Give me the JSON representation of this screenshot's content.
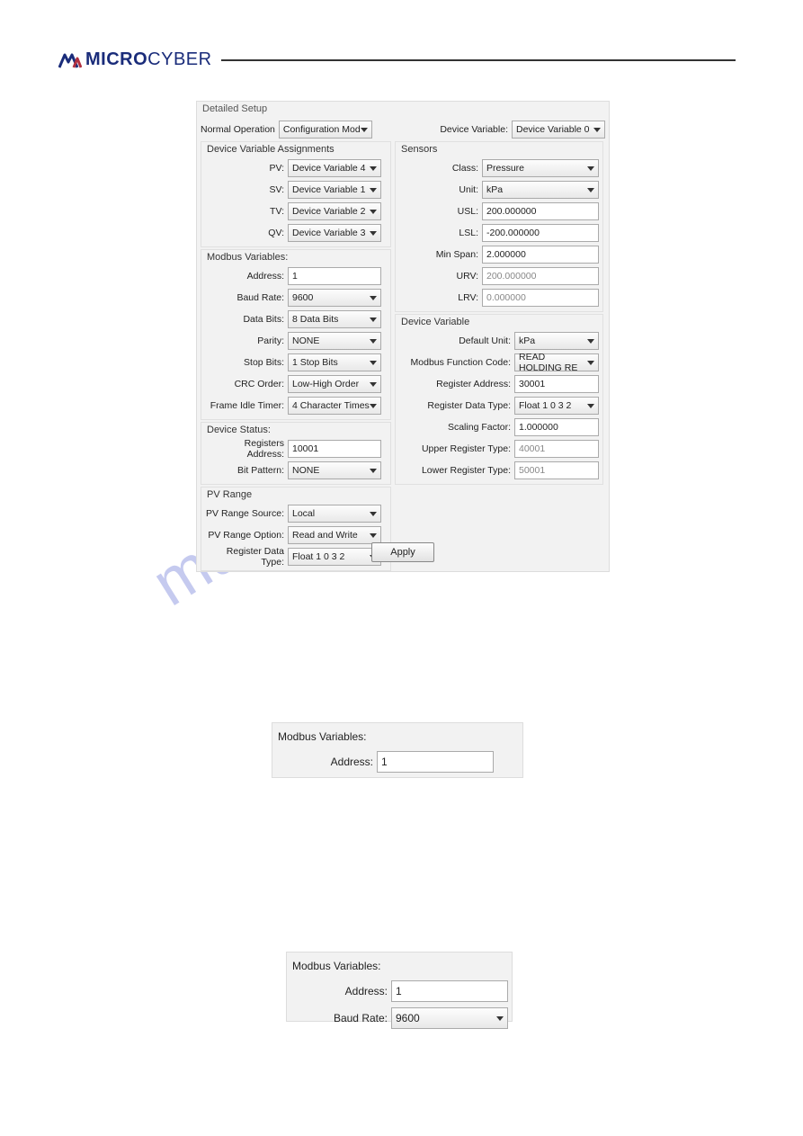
{
  "brand": {
    "name1": "MICRO",
    "name2": "CYBER"
  },
  "watermark": "manualshive.com",
  "dialog": {
    "title": "Detailed Setup",
    "normal_op_label": "Normal Operation",
    "normal_op_value": "Configuration Mod",
    "dev_var_label": "Device Variable:",
    "dev_var_value": "Device Variable 0"
  },
  "assignments": {
    "title": "Device Variable Assignments",
    "pv_label": "PV:",
    "pv_value": "Device Variable 4",
    "sv_label": "SV:",
    "sv_value": "Device Variable 1",
    "tv_label": "TV:",
    "tv_value": "Device Variable 2",
    "qv_label": "QV:",
    "qv_value": "Device Variable 3"
  },
  "modbus": {
    "title": "Modbus Variables:",
    "address_label": "Address:",
    "address_value": "1",
    "baud_label": "Baud Rate:",
    "baud_value": "9600",
    "databits_label": "Data Bits:",
    "databits_value": "8 Data Bits",
    "parity_label": "Parity:",
    "parity_value": "NONE",
    "stopbits_label": "Stop Bits:",
    "stopbits_value": "1 Stop Bits",
    "crc_label": "CRC Order:",
    "crc_value": "Low-High Order",
    "idle_label": "Frame Idle Timer:",
    "idle_value": "4 Character Times"
  },
  "status": {
    "title": "Device Status:",
    "reg_label": "Registers Address:",
    "reg_value": "10001",
    "bit_label": "Bit Pattern:",
    "bit_value": "NONE"
  },
  "pvrange": {
    "title": "PV Range",
    "src_label": "PV Range Source:",
    "src_value": "Local",
    "opt_label": "PV Range Option:",
    "opt_value": "Read and Write",
    "rdt_label": "Register Data Type:",
    "rdt_value": "Float 1 0 3 2"
  },
  "sensors": {
    "title": "Sensors",
    "class_label": "Class:",
    "class_value": "Pressure",
    "unit_label": "Unit:",
    "unit_value": "kPa",
    "usl_label": "USL:",
    "usl_value": "200.000000",
    "lsl_label": "LSL:",
    "lsl_value": "-200.000000",
    "span_label": "Min Span:",
    "span_value": "2.000000",
    "urv_label": "URV:",
    "urv_value": "200.000000",
    "lrv_label": "LRV:",
    "lrv_value": "0.000000"
  },
  "devvar": {
    "title": "Device  Variable",
    "defunit_label": "Default Unit:",
    "defunit_value": "kPa",
    "func_label": "Modbus Function Code:",
    "func_value": "READ HOLDING RE",
    "regaddr_label": "Register Address:",
    "regaddr_value": "30001",
    "rdt_label": "Register Data Type:",
    "rdt_value": "Float 1 0 3 2",
    "scale_label": "Scaling Factor:",
    "scale_value": "1.000000",
    "upper_label": "Upper Register Type:",
    "upper_value": "40001",
    "lower_label": "Lower Register Type:",
    "lower_value": "50001"
  },
  "apply_label": "Apply",
  "snippet1": {
    "title": "Modbus Variables:",
    "addr_label": "Address:",
    "addr_value": "1"
  },
  "snippet2": {
    "title": "Modbus Variables:",
    "addr_label": "Address:",
    "addr_value": "1",
    "baud_label": "Baud Rate:",
    "baud_value": "9600"
  }
}
